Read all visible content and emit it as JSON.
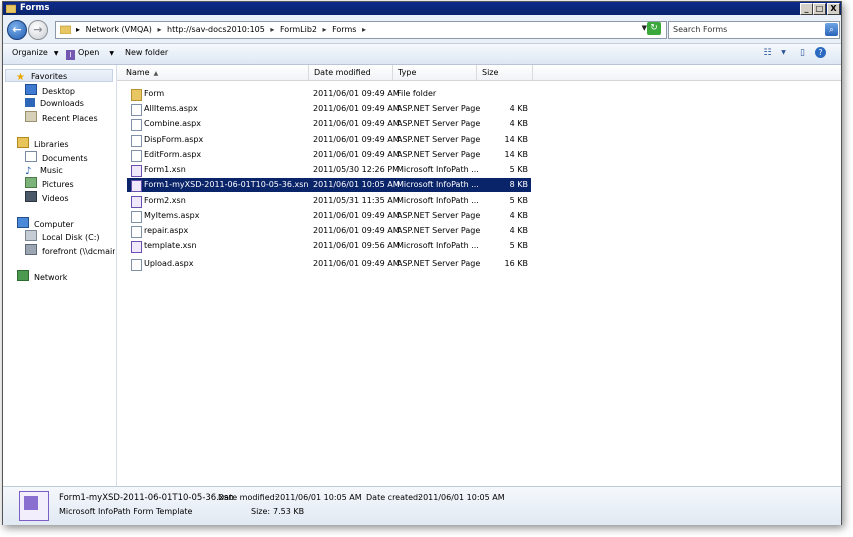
{
  "window": {
    "title": "Forms"
  },
  "titlebar_buttons": {
    "minimize": "_",
    "maximize": "□",
    "close": "X"
  },
  "address": {
    "crumbs": [
      "Network (VMQA)",
      "http://sav-docs2010:105",
      "FormLib2",
      "Forms"
    ],
    "separator": "▸",
    "dropdown": "▼"
  },
  "search": {
    "placeholder": "Search Forms"
  },
  "toolbar": {
    "organize": "Organize",
    "open": "Open",
    "new_folder": "New folder"
  },
  "nav": {
    "favorites": "Favorites",
    "desktop": "Desktop",
    "downloads": "Downloads",
    "recent": "Recent Places",
    "libraries": "Libraries",
    "documents": "Documents",
    "music": "Music",
    "pictures": "Pictures",
    "videos": "Videos",
    "computer": "Computer",
    "local_disk": "Local Disk (C:)",
    "forefront": "forefront (\\\\dcmain) (\\",
    "network": "Network"
  },
  "columns": {
    "name": "Name",
    "modified": "Date modified",
    "type": "Type",
    "size": "Size",
    "sort_indicator": "▲"
  },
  "files": [
    {
      "name": "Form",
      "modified": "2011/06/01 09:49 AM",
      "type": "File folder",
      "size": "",
      "kind": "folder"
    },
    {
      "name": "AllItems.aspx",
      "modified": "2011/06/01 09:49 AM",
      "type": "ASP.NET Server Page",
      "size": "4 KB",
      "kind": "aspx"
    },
    {
      "name": "Combine.aspx",
      "modified": "2011/06/01 09:49 AM",
      "type": "ASP.NET Server Page",
      "size": "4 KB",
      "kind": "aspx"
    },
    {
      "name": "DispForm.aspx",
      "modified": "2011/06/01 09:49 AM",
      "type": "ASP.NET Server Page",
      "size": "14 KB",
      "kind": "aspx"
    },
    {
      "name": "EditForm.aspx",
      "modified": "2011/06/01 09:49 AM",
      "type": "ASP.NET Server Page",
      "size": "14 KB",
      "kind": "aspx"
    },
    {
      "name": "Form1.xsn",
      "modified": "2011/05/30 12:26 PM",
      "type": "Microsoft InfoPath ...",
      "size": "5 KB",
      "kind": "xsn"
    },
    {
      "name": "Form1-myXSD-2011-06-01T10-05-36.xsn",
      "modified": "2011/06/01 10:05 AM",
      "type": "Microsoft InfoPath ...",
      "size": "8 KB",
      "kind": "xsn",
      "selected": true
    },
    {
      "name": "Form2.xsn",
      "modified": "2011/05/31 11:35 AM",
      "type": "Microsoft InfoPath ...",
      "size": "5 KB",
      "kind": "xsn"
    },
    {
      "name": "MyItems.aspx",
      "modified": "2011/06/01 09:49 AM",
      "type": "ASP.NET Server Page",
      "size": "4 KB",
      "kind": "aspx"
    },
    {
      "name": "repair.aspx",
      "modified": "2011/06/01 09:49 AM",
      "type": "ASP.NET Server Page",
      "size": "4 KB",
      "kind": "aspx"
    },
    {
      "name": "template.xsn",
      "modified": "2011/06/01 09:56 AM",
      "type": "Microsoft InfoPath ...",
      "size": "5 KB",
      "kind": "xsn"
    },
    {
      "name": "Upload.aspx",
      "modified": "2011/06/01 09:49 AM",
      "type": "ASP.NET Server Page",
      "size": "16 KB",
      "kind": "aspx"
    }
  ],
  "details": {
    "filename": "Form1-myXSD-2011-06-01T10-05-36.xsn",
    "modified_label": "Date modified:",
    "modified_value": "2011/06/01 10:05 AM",
    "created_label": "Date created:",
    "created_value": "2011/06/01 10:05 AM",
    "type": "Microsoft InfoPath Form Template",
    "size_label": "Size:",
    "size_value": "7.53 KB"
  },
  "colors": {
    "selection": "#0a246a",
    "titlebar": "#0a246a"
  }
}
